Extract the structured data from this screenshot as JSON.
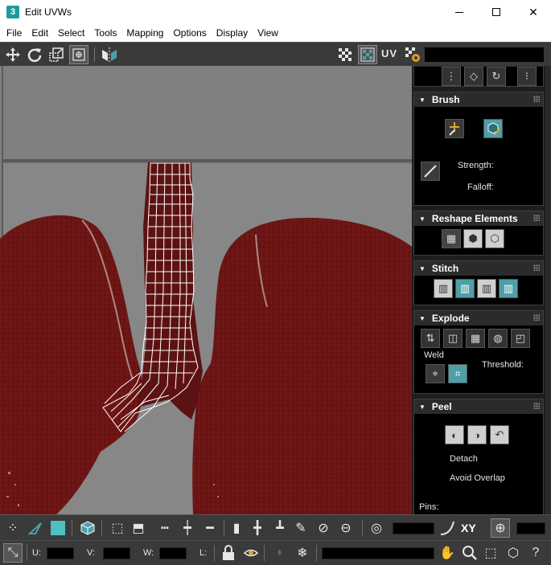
{
  "window": {
    "app_icon_glyph": "3",
    "title": "Edit UVWs",
    "controls": [
      "minimize",
      "maximize",
      "close"
    ]
  },
  "menu": [
    "File",
    "Edit",
    "Select",
    "Tools",
    "Mapping",
    "Options",
    "Display",
    "View"
  ],
  "toolbar": {
    "uv_label": "UV",
    "icons": [
      "move-icon",
      "rotate-icon",
      "scale-icon",
      "freeform-icon",
      "mirror-icon",
      "checker-icon",
      "show-map-icon",
      "map-options-icon"
    ]
  },
  "rollouts": {
    "brush": {
      "title": "Brush",
      "strength_label": "Strength:",
      "falloff_label": "Falloff:"
    },
    "reshape": {
      "title": "Reshape Elements"
    },
    "stitch": {
      "title": "Stitch"
    },
    "explode": {
      "title": "Explode",
      "weld_label": "Weld",
      "threshold_label": "Threshold:"
    },
    "peel": {
      "title": "Peel",
      "detach_label": "Detach",
      "avoid_overlap_label": "Avoid Overlap",
      "pins_label": "Pins:"
    }
  },
  "bottom": {
    "xy_label": "XY",
    "u_label": "U:",
    "v_label": "V:",
    "w_label": "W:",
    "l_label": "L:"
  },
  "colors": {
    "viewport_bg": "#7d7d7d",
    "lung_red": "#6b1414",
    "panel_bg": "#1e1e1e",
    "toolbar_bg": "#3a3a3a",
    "accent_teal": "#4d9fa8"
  }
}
